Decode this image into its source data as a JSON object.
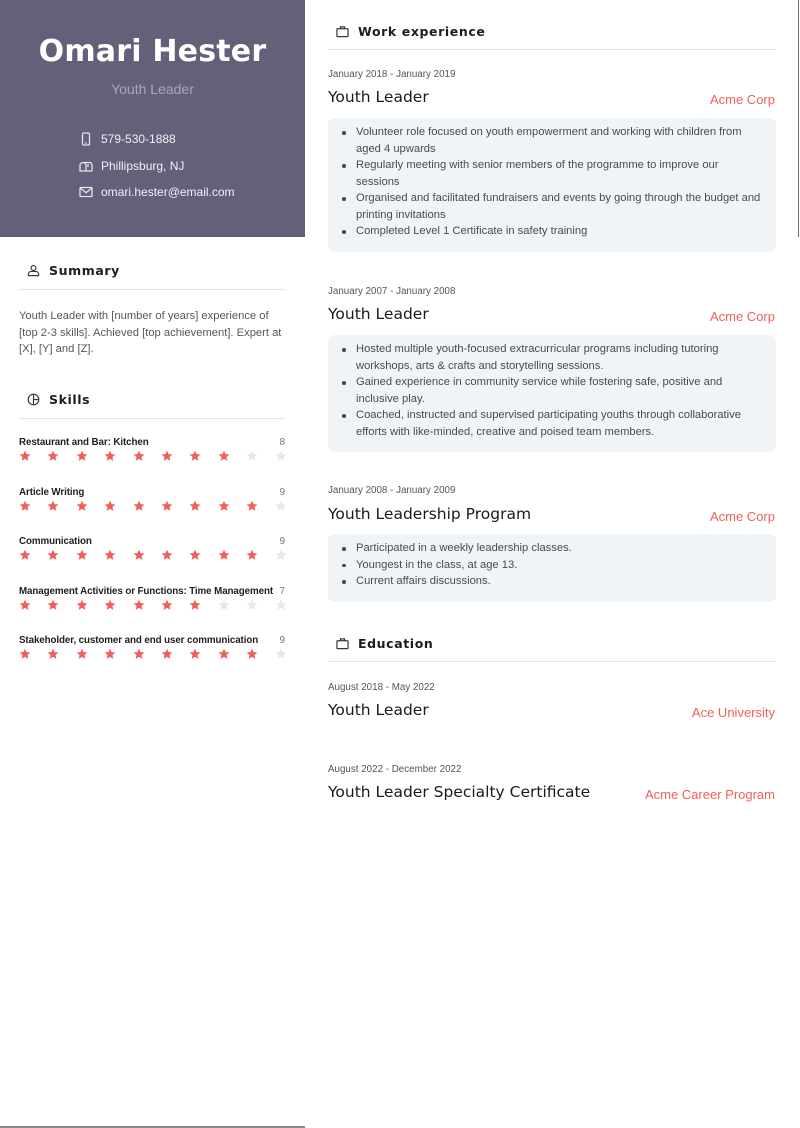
{
  "header": {
    "name": "Omari Hester",
    "role": "Youth Leader",
    "contacts": [
      {
        "icon": "phone-icon",
        "text": "579-530-1888"
      },
      {
        "icon": "location-mailbox-icon",
        "text": "Phillipsburg, NJ"
      },
      {
        "icon": "email-icon",
        "text": "omari.hester@email.com"
      }
    ]
  },
  "summary": {
    "title": "Summary",
    "icon": "person-icon",
    "text": "Youth Leader with [number of years] experience of [top 2-3 skills]. Achieved [top achievement]. Expert at [X], [Y] and [Z]."
  },
  "skills": {
    "title": "Skills",
    "icon": "pie-chart-icon",
    "max_rating": 10,
    "colors": {
      "filled": "#f0605a",
      "empty": "#e8e8ec"
    },
    "items": [
      {
        "name": "Restaurant and Bar: Kitchen",
        "rating": 8
      },
      {
        "name": "Article Writing",
        "rating": 9
      },
      {
        "name": "Communication",
        "rating": 9
      },
      {
        "name": "Management Activities or Functions: Time Management",
        "rating": 7
      },
      {
        "name": "Stakeholder, customer and end user communication",
        "rating": 9
      }
    ]
  },
  "work": {
    "title": "Work experience",
    "icon": "briefcase-icon",
    "entries": [
      {
        "dates": "January 2018 - January 2019",
        "title": "Youth Leader",
        "org": "Acme Corp",
        "bullets": [
          "Volunteer role focused on youth empowerment and working with children from aged 4 upwards",
          "Regularly meeting with senior members of the programme to improve our sessions",
          "Organised and facilitated fundraisers and events by going through the budget and printing invitations",
          "Completed Level 1 Certificate in safety training"
        ]
      },
      {
        "dates": "January 2007 - January 2008",
        "title": "Youth Leader",
        "org": "Acme Corp",
        "bullets": [
          "Hosted multiple youth-focused extracurricular programs including tutoring workshops, arts & crafts and storytelling sessions.",
          "Gained experience in community service while fostering safe, positive and inclusive play.",
          "Coached, instructed and supervised participating youths through collaborative efforts with like-minded, creative and poised team members."
        ]
      },
      {
        "dates": "January 2008 - January 2009",
        "title": "Youth Leadership Program",
        "org": "Acme Corp",
        "bullets": [
          "Participated in a weekly leadership classes.",
          "Youngest in the class, at age 13.",
          "Current affairs discussions."
        ]
      }
    ]
  },
  "education": {
    "title": "Education",
    "icon": "briefcase-icon",
    "entries": [
      {
        "dates": "August 2018 - May 2022",
        "title": "Youth Leader",
        "org": "Ace University"
      },
      {
        "dates": "August 2022 - December 2022",
        "title": "Youth Leader Specialty Certificate",
        "org": "Acme Career Program"
      }
    ]
  },
  "accent_color": "#f0605a",
  "sidebar_color": "#636079"
}
